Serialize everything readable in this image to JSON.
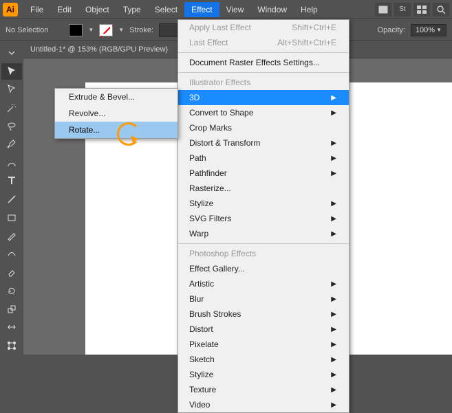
{
  "menubar": {
    "items": [
      "File",
      "Edit",
      "Object",
      "Type",
      "Select",
      "Effect",
      "View",
      "Window",
      "Help"
    ]
  },
  "optionbar": {
    "selection": "No Selection",
    "stroke_label": "Stroke:",
    "opacity_label": "Opacity:",
    "opacity_value": "100%"
  },
  "document": {
    "tab": "Untitled-1* @ 153% (RGB/GPU Preview)"
  },
  "effect_menu": {
    "apply_last": "Apply Last Effect",
    "apply_last_sc": "Shift+Ctrl+E",
    "last": "Last Effect",
    "last_sc": "Alt+Shift+Ctrl+E",
    "raster": "Document Raster Effects Settings...",
    "sec1": "Illustrator Effects",
    "i3d": "3D",
    "convert": "Convert to Shape",
    "crop": "Crop Marks",
    "distort": "Distort & Transform",
    "path": "Path",
    "pathfinder": "Pathfinder",
    "rasterize": "Rasterize...",
    "stylize1": "Stylize",
    "svg": "SVG Filters",
    "warp": "Warp",
    "sec2": "Photoshop Effects",
    "gallery": "Effect Gallery...",
    "artistic": "Artistic",
    "blur": "Blur",
    "brush": "Brush Strokes",
    "distort2": "Distort",
    "pixelate": "Pixelate",
    "sketch": "Sketch",
    "stylize2": "Stylize",
    "texture": "Texture",
    "video": "Video"
  },
  "submenu_3d": {
    "extrude": "Extrude & Bevel...",
    "revolve": "Revolve...",
    "rotate": "Rotate..."
  },
  "stock_label": "St"
}
